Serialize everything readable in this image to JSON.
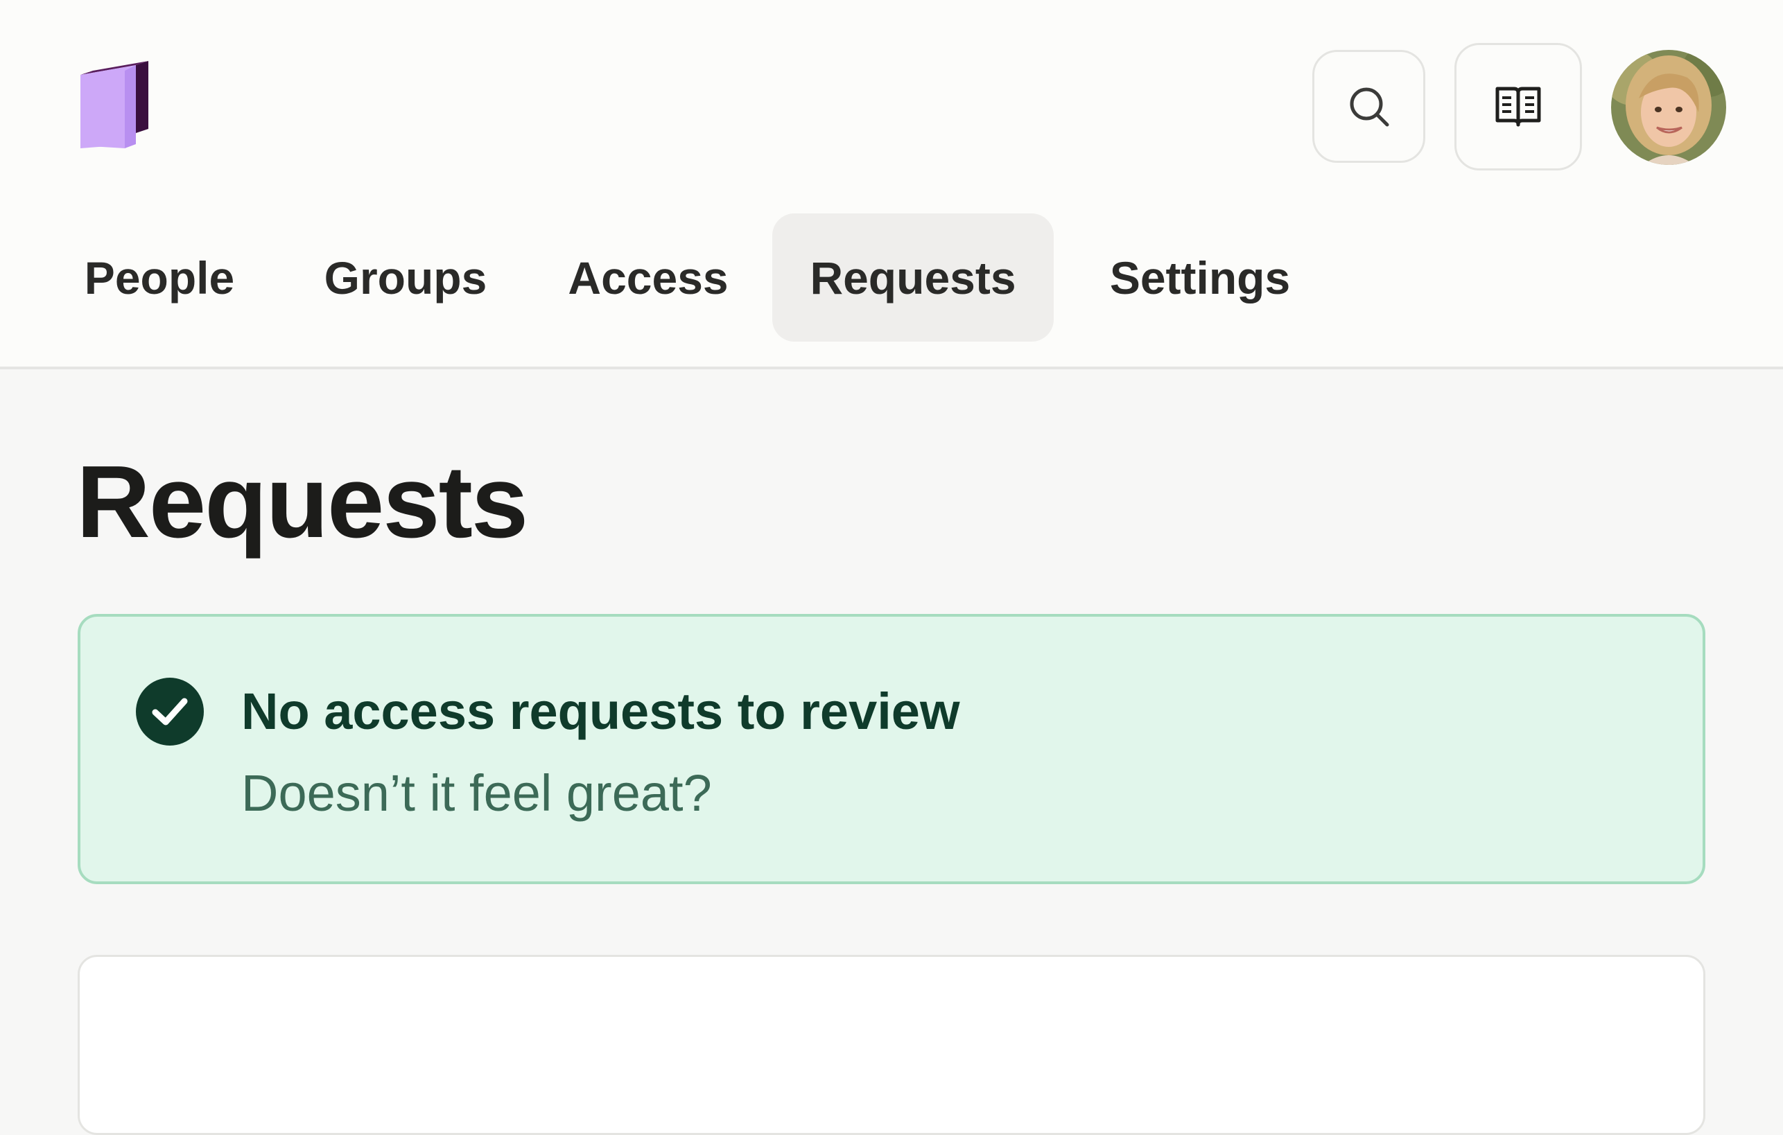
{
  "header": {
    "logo_icon": "box-logo-icon",
    "search_icon": "search-icon",
    "docs_icon": "open-book-icon",
    "avatar_icon": "user-avatar"
  },
  "nav": {
    "items": [
      {
        "label": "People",
        "active": false
      },
      {
        "label": "Groups",
        "active": false
      },
      {
        "label": "Access",
        "active": false
      },
      {
        "label": "Requests",
        "active": true
      },
      {
        "label": "Settings",
        "active": false
      }
    ]
  },
  "main": {
    "title": "Requests",
    "alert": {
      "icon": "check-circle-icon",
      "title": "No access requests to review",
      "subtitle": "Doesn’t it feel great?"
    }
  },
  "colors": {
    "logo_primary": "#cda8f8",
    "logo_dark": "#3a0f3f",
    "success_bg": "#e1f6eb",
    "success_border": "#a6dcbf",
    "success_dark": "#0f3b2b",
    "active_tab_bg": "#efeeec"
  }
}
